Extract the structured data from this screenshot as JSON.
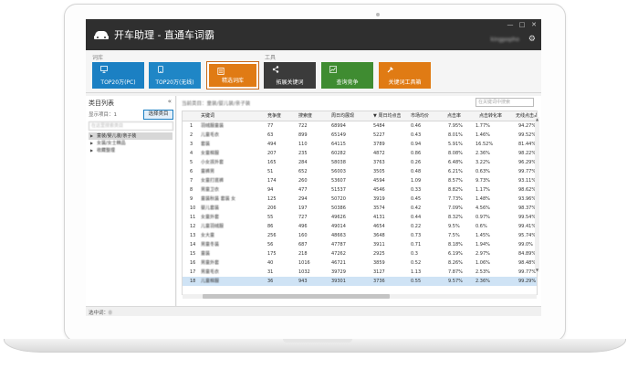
{
  "window": {
    "title": "开车助理 - 直通车词霸",
    "username": "kingpopho",
    "controls": [
      "—",
      "□",
      "✕"
    ]
  },
  "ribbon": {
    "groups": [
      {
        "label": "词库"
      },
      {
        "label": "工具"
      }
    ],
    "buttons": [
      {
        "label": "TOP20万(PC)",
        "icon": "monitor-icon"
      },
      {
        "label": "TOP20万(无线)",
        "icon": "mobile-icon"
      },
      {
        "label": "精选词库",
        "icon": "book-icon"
      },
      {
        "label": "拓展关键词",
        "icon": "share-icon"
      },
      {
        "label": "查询竞争",
        "icon": "chart-icon"
      },
      {
        "label": "关键词工具箱",
        "icon": "tools-icon"
      }
    ]
  },
  "left_panel": {
    "title": "类目列表",
    "collapse_icon": "«",
    "count_label": "显示项目：1",
    "select_button": "选择类目",
    "search_placeholder": "在这里搜索类目",
    "tree": [
      {
        "label": "童装/婴儿装/亲子装",
        "selected": true
      },
      {
        "label": "女装/女士精品",
        "selected": false
      },
      {
        "label": "收藏整理",
        "selected": false
      }
    ]
  },
  "right_panel": {
    "path": "当前类目：童装/婴儿装/亲子装",
    "search_placeholder": "在关键词中搜索"
  },
  "table": {
    "columns": [
      "关键词",
      "竞争度",
      "搜索度",
      "周日均展现",
      "周日均点击",
      "市场均价",
      "点击率",
      "点击转化率",
      "无线点击占比"
    ],
    "sort_column": 4,
    "selected_row": 17,
    "rows": [
      [
        "1",
        "羽绒服童装",
        "77",
        "722",
        "68994",
        "5484",
        "0.46",
        "7.95%",
        "1.77%",
        "94.27%"
      ],
      [
        "2",
        "儿童毛衣",
        "63",
        "899",
        "65149",
        "5227",
        "0.43",
        "8.01%",
        "1.46%",
        "99.52%"
      ],
      [
        "3",
        "套装",
        "494",
        "110",
        "64115",
        "3789",
        "0.94",
        "5.91%",
        "16.52%",
        "81.44%"
      ],
      [
        "4",
        "女童棉服",
        "207",
        "235",
        "60282",
        "4872",
        "0.86",
        "8.08%",
        "2.36%",
        "98.22%"
      ],
      [
        "5",
        "小女孩外套",
        "165",
        "284",
        "58038",
        "3763",
        "0.26",
        "6.48%",
        "3.22%",
        "96.29%"
      ],
      [
        "6",
        "童裤男",
        "51",
        "652",
        "56003",
        "3505",
        "0.48",
        "6.21%",
        "0.63%",
        "99.77%"
      ],
      [
        "7",
        "女童打底裤",
        "174",
        "260",
        "53607",
        "4594",
        "1.09",
        "8.57%",
        "9.73%",
        "93.11%"
      ],
      [
        "8",
        "男童卫衣",
        "94",
        "477",
        "51537",
        "4546",
        "0.33",
        "8.82%",
        "1.17%",
        "98.62%"
      ],
      [
        "9",
        "童装秋装 套装 女",
        "125",
        "294",
        "50720",
        "3919",
        "0.45",
        "7.73%",
        "1.48%",
        "93.96%"
      ],
      [
        "10",
        "婴儿套装",
        "206",
        "197",
        "50386",
        "3574",
        "0.42",
        "7.09%",
        "4.56%",
        "98.37%"
      ],
      [
        "11",
        "女童外套",
        "55",
        "727",
        "49626",
        "4131",
        "0.44",
        "8.32%",
        "0.97%",
        "99.54%"
      ],
      [
        "12",
        "儿童羽绒服",
        "86",
        "496",
        "49014",
        "4654",
        "0.22",
        "9.5%",
        "0.6%",
        "99.41%"
      ],
      [
        "13",
        "女大童",
        "256",
        "160",
        "48663",
        "3648",
        "0.73",
        "7.5%",
        "1.45%",
        "95.74%"
      ],
      [
        "14",
        "男童冬装",
        "56",
        "687",
        "47787",
        "3911",
        "0.71",
        "8.18%",
        "1.94%",
        "99.0%"
      ],
      [
        "15",
        "童装",
        "175",
        "218",
        "47262",
        "2925",
        "0.3",
        "6.19%",
        "2.97%",
        "84.89%"
      ],
      [
        "16",
        "男童外套",
        "40",
        "1016",
        "46721",
        "3859",
        "0.52",
        "8.26%",
        "1.06%",
        "98.48%"
      ],
      [
        "17",
        "男童毛衣",
        "31",
        "1032",
        "39729",
        "3127",
        "1.13",
        "7.87%",
        "2.53%",
        "99.77%"
      ],
      [
        "18",
        "儿童棉服",
        "36",
        "943",
        "39301",
        "3736",
        "0.55",
        "9.57%",
        "2.36%",
        "99.29%"
      ]
    ]
  },
  "status": {
    "label": "选中词：",
    "value": "0"
  }
}
